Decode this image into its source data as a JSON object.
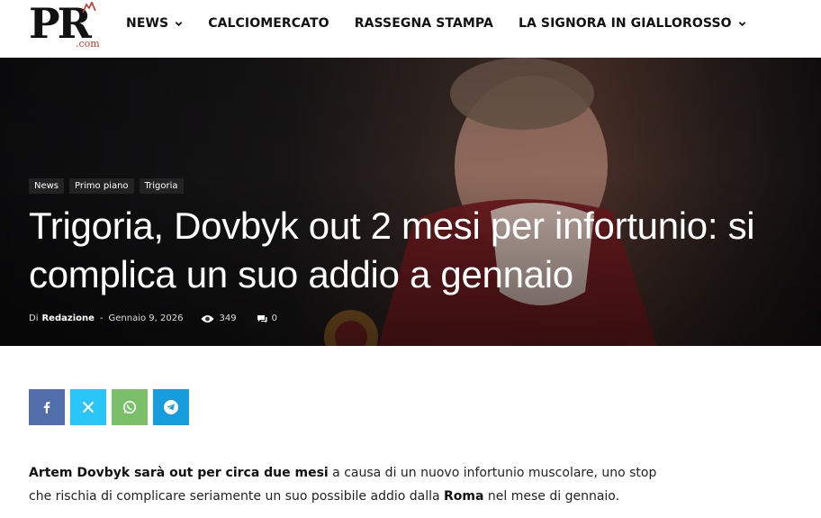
{
  "logo": {
    "text": "PR",
    "suffix": ".com"
  },
  "nav": {
    "items": [
      {
        "label": "NEWS",
        "has_dropdown": true
      },
      {
        "label": "CALCIOMERCATO",
        "has_dropdown": false
      },
      {
        "label": "RASSEGNA STAMPA",
        "has_dropdown": false
      },
      {
        "label": "LA SIGNORA IN GIALLOROSSO",
        "has_dropdown": true
      }
    ]
  },
  "hero": {
    "tags": [
      "News",
      "Primo piano",
      "Trigoria"
    ],
    "title": "Trigoria, Dovbyk out 2 mesi per infortunio: si complica un suo addio a gennaio",
    "meta": {
      "by": "Di",
      "author": "Redazione",
      "separator": "-",
      "date": "Gennaio 9, 2026",
      "views": "349",
      "comments": "0"
    }
  },
  "share": {
    "buttons": [
      "facebook-icon",
      "x-icon",
      "whatsapp-icon",
      "telegram-icon"
    ]
  },
  "article": {
    "p1_bold1": "Artem Dovbyk sarà out per circa due mesi",
    "p1_text1": " a causa di un nuovo infortunio muscolare, uno stop che rischia di complicare seriamente un suo possibile addio dalla ",
    "p1_bold2": "Roma",
    "p1_text2": " nel mese di gennaio."
  },
  "colors": {
    "facebook": "#516eab",
    "x": "#29c5f6",
    "whatsapp": "#7bbf6a",
    "telegram": "#179cde",
    "logo_accent": "#c0392b"
  }
}
